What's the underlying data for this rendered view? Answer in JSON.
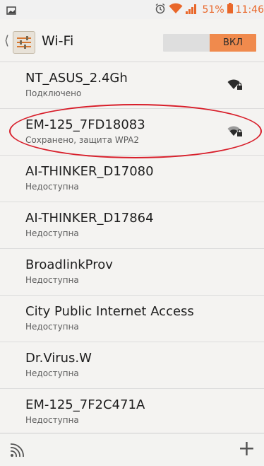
{
  "status_bar": {
    "battery_percent": "51%",
    "time": "11:46",
    "icons": [
      "image-icon",
      "alarm-icon",
      "wifi-icon",
      "signal-icon",
      "battery-icon"
    ]
  },
  "action_bar": {
    "title": "Wi-Fi",
    "toggle_label": "ВКЛ"
  },
  "networks": [
    {
      "ssid": "NT_ASUS_2.4Gh",
      "status": "Подключено",
      "secured": true
    },
    {
      "ssid": "EM-125_7FD18083",
      "status": "Сохранено, защита WPA2",
      "secured": true
    },
    {
      "ssid": "AI-THINKER_D17080",
      "status": "Недоступна",
      "secured": false
    },
    {
      "ssid": "AI-THINKER_D17864",
      "status": "Недоступна",
      "secured": false
    },
    {
      "ssid": "BroadlinkProv",
      "status": "Недоступна",
      "secured": false
    },
    {
      "ssid": "City Public Internet Access",
      "status": "Недоступна",
      "secured": false
    },
    {
      "ssid": "Dr.Virus.W",
      "status": "Недоступна",
      "secured": false
    },
    {
      "ssid": "EM-125_7F2C471A",
      "status": "Недоступна",
      "secured": false
    }
  ],
  "bottom_bar": {
    "icons": [
      "wifi-scan-icon",
      "add-icon"
    ]
  },
  "colors": {
    "accent": "#e9672a",
    "toggle_on": "#f08a4d",
    "highlight": "#d81e2a"
  }
}
